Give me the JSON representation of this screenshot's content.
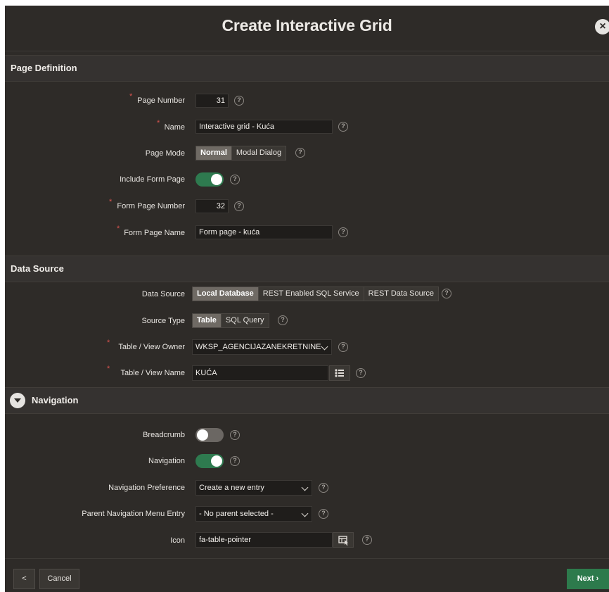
{
  "dialog": {
    "title": "Create Interactive Grid",
    "close": "×"
  },
  "page_definition": {
    "title": "Page Definition",
    "page_number_label": "Page Number",
    "page_number": "31",
    "name_label": "Name",
    "name": "Interactive grid - Kuća",
    "page_mode_label": "Page Mode",
    "page_mode_options": [
      "Normal",
      "Modal Dialog"
    ],
    "page_mode_selected": "Normal",
    "include_form_label": "Include Form Page",
    "include_form": true,
    "form_page_number_label": "Form Page Number",
    "form_page_number": "32",
    "form_page_name_label": "Form Page Name",
    "form_page_name": "Form page - kuća"
  },
  "data_source": {
    "title": "Data Source",
    "data_source_label": "Data Source",
    "data_source_options": [
      "Local Database",
      "REST Enabled SQL Service",
      "REST Data Source"
    ],
    "data_source_selected": "Local Database",
    "source_type_label": "Source Type",
    "source_type_options": [
      "Table",
      "SQL Query"
    ],
    "source_type_selected": "Table",
    "owner_label": "Table / View Owner",
    "owner": "WKSP_AGENCIJAZANEKRETNINE",
    "table_label": "Table / View Name",
    "table": "KUĆA"
  },
  "navigation": {
    "title": "Navigation",
    "breadcrumb_label": "Breadcrumb",
    "breadcrumb": false,
    "navigation_label": "Navigation",
    "navigation": true,
    "preference_label": "Navigation Preference",
    "preference": "Create a new entry",
    "parent_label": "Parent Navigation Menu Entry",
    "parent": "- No parent selected -",
    "icon_label": "Icon",
    "icon": "fa-table-pointer"
  },
  "footer": {
    "back": "<",
    "cancel": "Cancel",
    "next": "Next"
  },
  "help_glyph": "?",
  "required_glyph": "*",
  "colors": {
    "accent": "#2d7a4c",
    "background": "#2e2b28",
    "required": "#d9534f"
  }
}
